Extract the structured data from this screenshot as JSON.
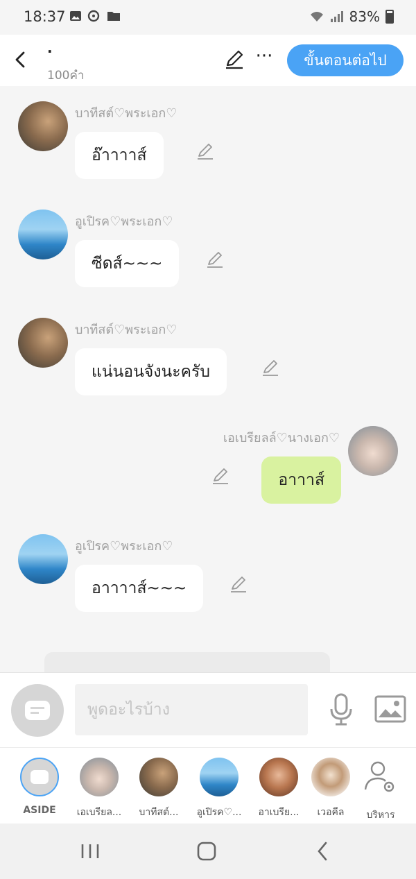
{
  "status_bar": {
    "time": "18:37",
    "battery": "83%"
  },
  "header": {
    "title": "·",
    "word_count": "100คำ",
    "next_button": "ขั้นตอนต่อไป",
    "more_glyph": "···"
  },
  "messages": [
    {
      "name": "บาทีสต์♡พระเอก♡",
      "text": "อ๊าาาาส์",
      "side": "left"
    },
    {
      "name": "อูเปิรค♡พระเอก♡",
      "text": "ซีดส์~~~",
      "side": "left"
    },
    {
      "name": "บาทีสต์♡พระเอก♡",
      "text": "แน่นอนจังนะครับ",
      "side": "left"
    },
    {
      "name": "เอเบรียลล์♡นางเอก♡",
      "text": "อาาาส์",
      "side": "right"
    },
    {
      "name": "อูเปิรค♡พระเอก♡",
      "text": "อาาาาส์~~~",
      "side": "left"
    }
  ],
  "input": {
    "placeholder": "พูดอะไรบ้าง"
  },
  "characters": [
    {
      "label": "ASIDE"
    },
    {
      "label": "เอเบรียล..."
    },
    {
      "label": "บาทีสต์..."
    },
    {
      "label": "อูเปิรค♡..."
    },
    {
      "label": "อาเบรีย..."
    },
    {
      "label": "เวอคีล"
    },
    {
      "label": "บริหาร"
    }
  ],
  "colors": {
    "accent": "#4aa3f5",
    "my_bubble": "#d9f2a0",
    "other_bubble": "#ffffff",
    "background": "#f5f5f5"
  }
}
